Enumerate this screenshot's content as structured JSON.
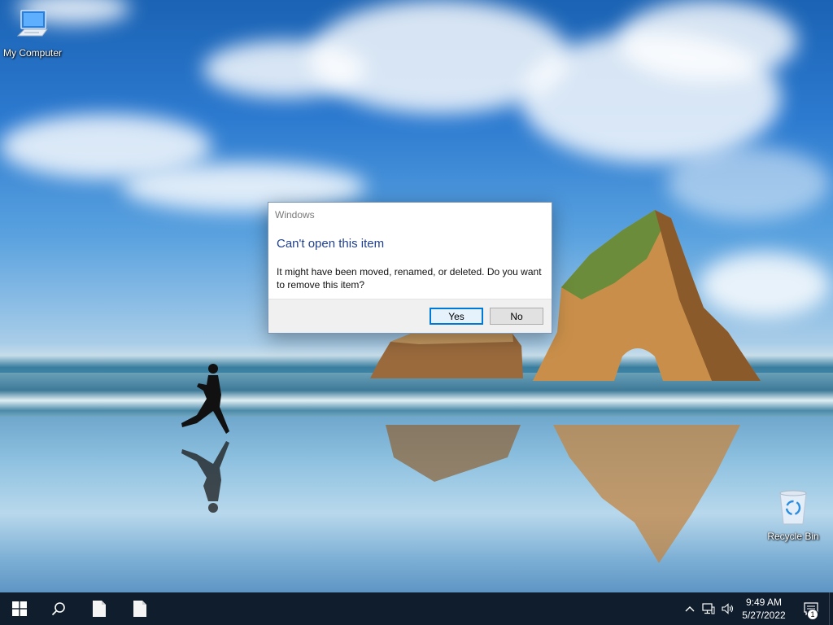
{
  "desktop": {
    "icons": [
      {
        "label": "My Computer",
        "icon": "computer-icon"
      },
      {
        "label": "Recycle Bin",
        "icon": "recycle-bin-icon"
      }
    ]
  },
  "dialog": {
    "title": "Windows",
    "heading": "Can't open this item",
    "message": "It might have been moved, renamed, or deleted. Do you want to remove this item?",
    "yes_label": "Yes",
    "no_label": "No",
    "heading_color": "#1f3f8f",
    "default_button_border": "#0078d7"
  },
  "taskbar": {
    "background": "#0f1d2d",
    "start_icon": "windows-logo-icon",
    "search_icon": "search-icon",
    "pinned": [
      "document-icon",
      "document-icon"
    ],
    "tray_icons": [
      "chevron-up-icon",
      "network-icon",
      "volume-icon"
    ],
    "clock": {
      "time": "9:49 AM",
      "date": "5/27/2022"
    },
    "notification_count": "1"
  }
}
